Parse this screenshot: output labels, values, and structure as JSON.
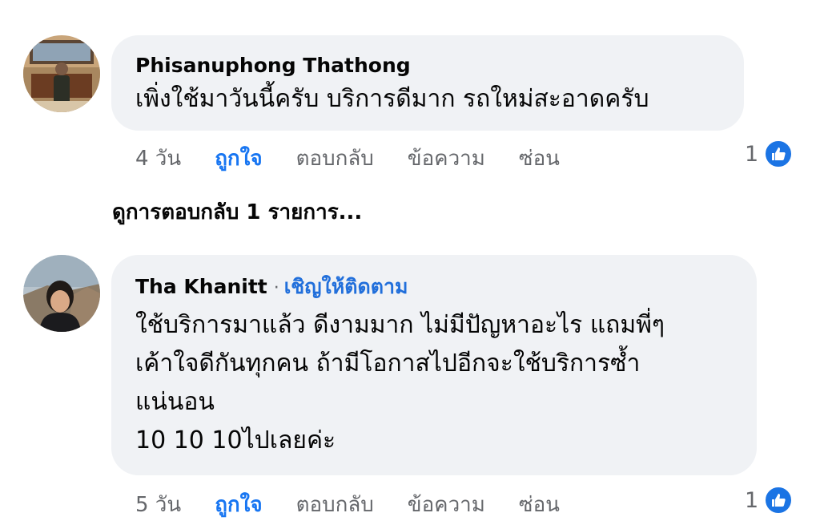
{
  "comments": [
    {
      "author": "Phisanuphong Thathong",
      "text": "เพิ่งใช้มาวันนี้ครับ บริการดีมาก รถใหม่สะอาดครับ",
      "time": "4 วัน",
      "like_label": "ถูกใจ",
      "reply_label": "ตอบกลับ",
      "message_label": "ข้อความ",
      "hide_label": "ซ่อน",
      "reaction_count": "1",
      "reaction_icon": "thumbs-up-icon"
    },
    {
      "author": "Tha Khanitt",
      "follow_label": "เชิญให้ติดตาม",
      "text": "ใช้บริการมาแล้ว ดีงามมาก ไม่มีปัญหาอะไร แถมพี่ๆ\nเค้าใจดีกันทุกคน ถ้ามีโอกาสไปอีกจะใช้บริการซ้ำ\nแน่นอน\n10 10 10ไปเลยค่ะ",
      "time": "5 วัน",
      "like_label": "ถูกใจ",
      "reply_label": "ตอบกลับ",
      "message_label": "ข้อความ",
      "hide_label": "ซ่อน",
      "reaction_count": "1",
      "reaction_icon": "thumbs-up-icon"
    }
  ],
  "view_replies_label": "ดูการตอบกลับ 1 รายการ...",
  "colors": {
    "bubble": "#f0f2f5",
    "link_blue": "#1876f2",
    "meta_gray": "#65676b",
    "like_badge": "#1b74e4"
  }
}
